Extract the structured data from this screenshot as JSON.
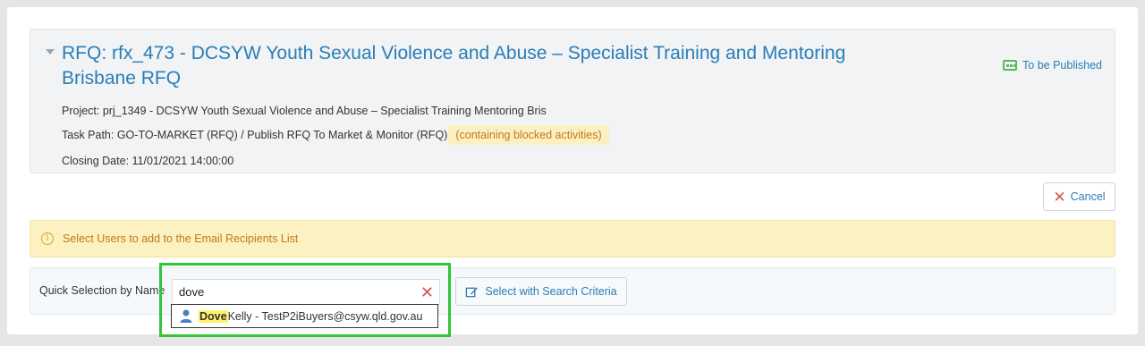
{
  "rfq": {
    "title": "RFQ: rfx_473 - DCSYW Youth Sexual Violence and Abuse – Specialist Training and Mentoring Brisbane RFQ",
    "status": "To be Published",
    "project": "Project: prj_1349 - DCSYW Youth Sexual Violence and Abuse – Specialist Training Mentoring Bris",
    "task_path": "Task Path: GO-TO-MARKET (RFQ) / Publish RFQ To Market & Monitor (RFQ)",
    "blocked_badge": "(containing blocked activities)",
    "closing_date": "Closing Date: 11/01/2021 14:00:00"
  },
  "actions": {
    "cancel_label": "Cancel"
  },
  "alert": {
    "message": "Select Users to add to the Email Recipients List"
  },
  "quick_select": {
    "label": "Quick Selection by Name",
    "input_value": "dove",
    "criteria_button": "Select with Search Criteria"
  },
  "suggestion": {
    "match": "Dove",
    "rest": " Kelly - TestP2iBuyers@csyw.qld.gov.au"
  },
  "colors": {
    "link": "#2a7db8",
    "status_icon": "#5cb85c",
    "warning_text": "#c2791a",
    "warning_bg": "#fcf1c0",
    "danger": "#d9534f",
    "focus_ring": "#31c53a"
  },
  "icons": [
    "collapse-caret-icon",
    "ticket-icon",
    "close-icon",
    "info-icon",
    "clear-icon",
    "edit-icon",
    "user-icon"
  ]
}
